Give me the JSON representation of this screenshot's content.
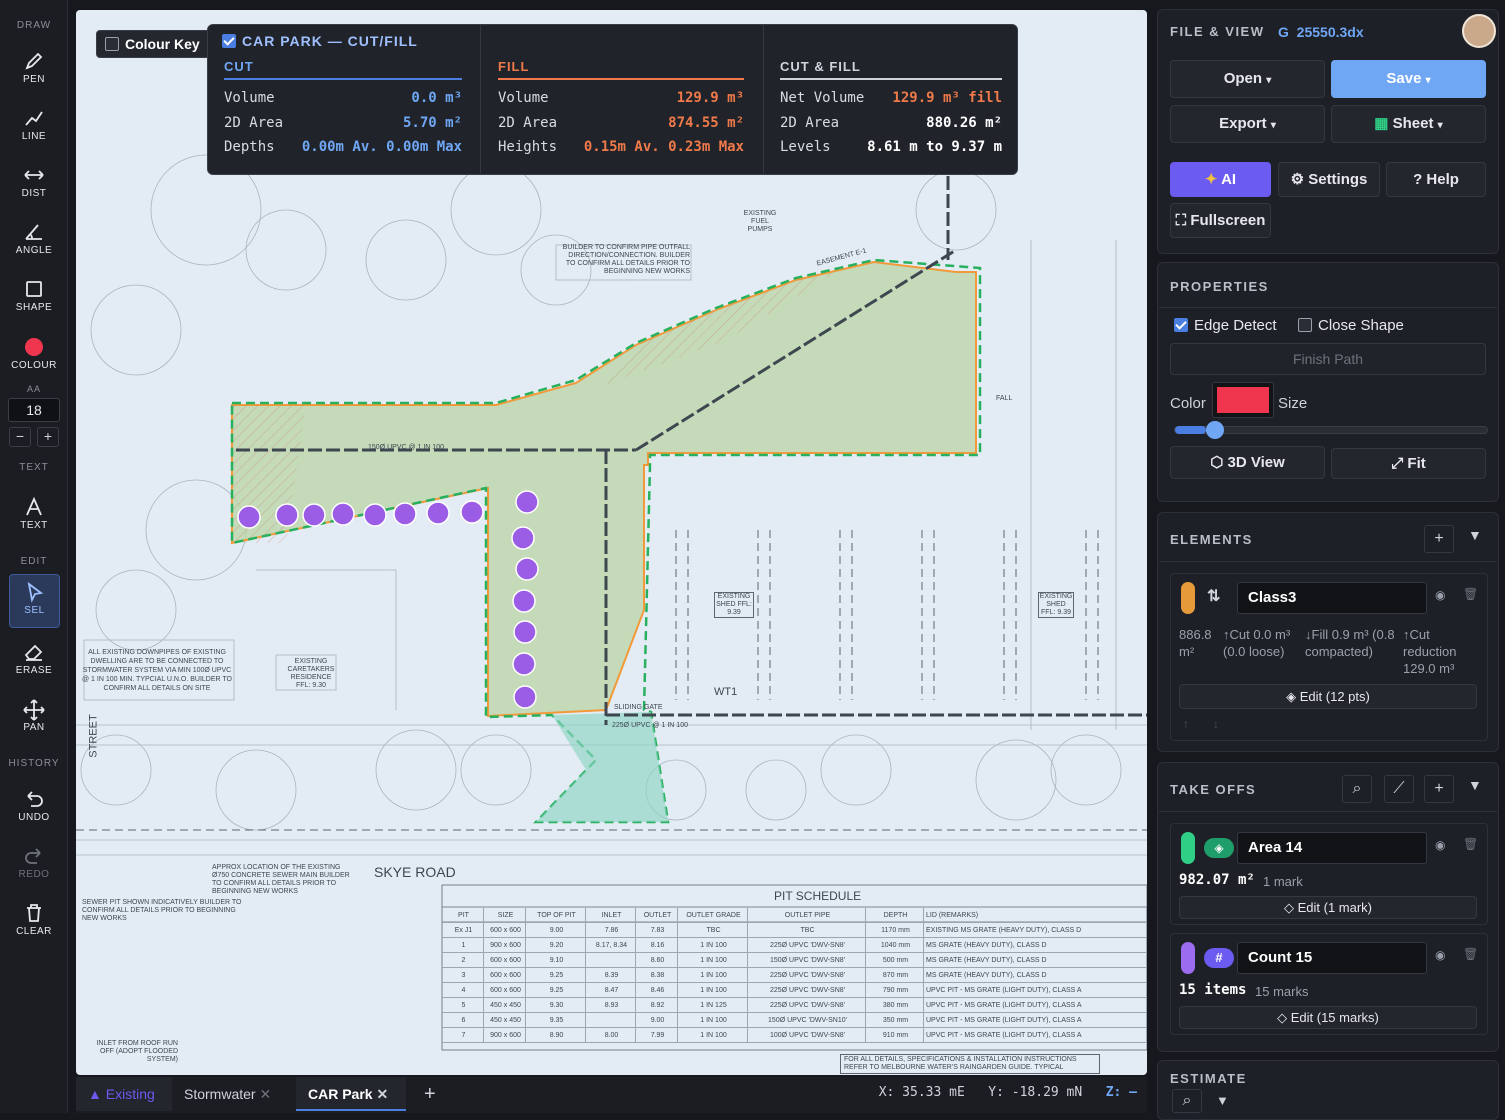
{
  "toolbar": {
    "draw_label": "DRAW",
    "pen": "PEN",
    "line": "LINE",
    "dist": "DIST",
    "angle": "ANGLE",
    "shape": "SHAPE",
    "colour": "COLOUR",
    "aa": "AA",
    "size_value": "18",
    "minus": "−",
    "plus": "+",
    "text_label": "TEXT",
    "text": "TEXT",
    "edit_label": "EDIT",
    "sel": "SEL",
    "erase": "ERASE",
    "pan": "PAN",
    "history_label": "HISTORY",
    "undo": "UNDO",
    "redo": "REDO",
    "clear": "CLEAR",
    "colour_value": "#f0364f"
  },
  "colour_key": {
    "label": "Colour Key"
  },
  "cutfill": {
    "title": "CAR PARK — CUT/FILL",
    "cut": {
      "header": "CUT",
      "rows": [
        {
          "label": "Volume",
          "value": "0.0 m³"
        },
        {
          "label": "2D Area",
          "value": "5.70 m²"
        }
      ],
      "depths_label": "Depths",
      "depths_value": "0.00m Av. 0.00m Max"
    },
    "fill": {
      "header": "FILL",
      "rows": [
        {
          "label": "Volume",
          "value": "129.9 m³"
        },
        {
          "label": "2D Area",
          "value": "874.55 m²"
        }
      ],
      "heights_label": "Heights",
      "heights_value": "0.15m Av. 0.23m Max"
    },
    "cutfill": {
      "header": "CUT & FILL",
      "rows": [
        {
          "label": "Net Volume",
          "value": "129.9 m³ fill"
        },
        {
          "label": "2D Area",
          "value": "880.26 m²"
        },
        {
          "label": "Levels",
          "value": "8.61 m to 9.37 m"
        }
      ]
    }
  },
  "drawing": {
    "road": "SKYE ROAD",
    "street": "STREET",
    "pit_schedule_title": "PIT SCHEDULE",
    "pit_headers": [
      "PIT",
      "SIZE",
      "TOP OF PIT",
      "INLET",
      "OUTLET",
      "OUTLET GRADE",
      "OUTLET PIPE",
      "DEPTH",
      "LID (REMARKS)"
    ],
    "pit_rows": [
      [
        "Ex J1",
        "600 x 600",
        "9.00",
        "7.86",
        "7.83",
        "TBC",
        "TBC",
        "1170 mm",
        "EXISTING MS GRATE (HEAVY DUTY), CLASS D"
      ],
      [
        "1",
        "900 x 600",
        "9.20",
        "8.17, 8.34",
        "8.16",
        "1 IN 100",
        "225Ø UPVC 'DWV-SN8'",
        "1040 mm",
        "MS GRATE (HEAVY DUTY), CLASS D"
      ],
      [
        "2",
        "600 x 600",
        "9.10",
        "",
        "8.60",
        "1 IN 100",
        "150Ø UPVC 'DWV-SN8'",
        "500 mm",
        "MS GRATE (HEAVY DUTY), CLASS D"
      ],
      [
        "3",
        "600 x 600",
        "9.25",
        "8.39",
        "8.38",
        "1 IN 100",
        "225Ø UPVC 'DWV-SN8'",
        "870 mm",
        "MS GRATE (HEAVY DUTY), CLASS D"
      ],
      [
        "4",
        "600 x 600",
        "9.25",
        "8.47",
        "8.46",
        "1 IN 100",
        "225Ø UPVC 'DWV-SN8'",
        "790 mm",
        "UPVC PIT - MS GRATE (LIGHT DUTY), CLASS A"
      ],
      [
        "5",
        "450 x 450",
        "9.30",
        "8.93",
        "8.92",
        "1 IN 125",
        "225Ø UPVC 'DWV-SN8'",
        "380 mm",
        "UPVC PIT - MS GRATE (LIGHT DUTY), CLASS A"
      ],
      [
        "6",
        "450 x 450",
        "9.35",
        "",
        "9.00",
        "1 IN 100",
        "150Ø UPVC 'DWV-SN10'",
        "350 mm",
        "UPVC PIT - MS GRATE (LIGHT DUTY), CLASS A"
      ],
      [
        "7",
        "900 x 600",
        "8.90",
        "8.00",
        "7.99",
        "1 IN 100",
        "100Ø UPVC 'DWV-SN8'",
        "910 mm",
        "UPVC PIT - MS GRATE (LIGHT DUTY), CLASS A"
      ]
    ],
    "note_downpipes": "ALL EXISTING DOWNPIPES OF EXISTING DWELLING ARE TO BE CONNECTED TO STORMWATER SYSTEM VIA MIN 100Ø UPVC @ 1 IN 100 MIN. TYPCIAL U.N.O. BUILDER TO CONFIRM ALL DETAILS ON SITE",
    "note_sewer": "APPROX LOCATION OF THE EXISTING Ø750 CONCRETE SEWER MAIN BUILDER TO CONFIRM ALL DETAILS PRIOR TO BEGINNING NEW WORKS",
    "note_builder": "BUILDER TO CONFIRM PIPE OUTFALL DIRECTION/CONNECTION. BUILDER TO CONFIRM ALL DETAILS PRIOR TO BEGINNING NEW WORKS",
    "note_sewer_pit": "SEWER PIT SHOWN INDICATIVELY BUILDER TO CONFIRM ALL DETAILS PRIOR TO BEGINNING NEW WORKS",
    "note_bottom": "FOR ALL DETAILS, SPECIFICATIONS & INSTALLATION INSTRUCTIONS REFER TO MELBOURNE WATER'S RAINGARDEN GUIDE. TYPICAL",
    "wt1": "WT1",
    "shed1": "EXISTING SHED FFL: 9.39",
    "shed2": "EXISTING SHED FFL: 9.39",
    "caretaker": "EXISTING CARETAKERS RESIDENCE FFL: 9.30",
    "fuel": "EXISTING FUEL PUMPS",
    "pipe1": "225Ø UPVC @ 1 IN 100",
    "pipe2": "150Ø UPVC @ 1 IN 100",
    "inlet": "INLET FROM ROOF RUN OFF (ADOPT FLOODED SYSTEM)",
    "sliding_gate": "SLIDING GATE",
    "easement": "EASEMENT E-1",
    "fall": "FALL"
  },
  "tabs": {
    "items": [
      {
        "label": "Existing"
      },
      {
        "label": "Stormwater"
      },
      {
        "label": "CAR Park"
      }
    ],
    "add": "+",
    "coord_x": "X: 35.33 mE",
    "coord_y": "Y: -18.29 mN",
    "coord_z": "Z: —"
  },
  "file_view": {
    "title": "FILE & VIEW",
    "file_icon": "G",
    "file_name": "25550.3dx",
    "open": "Open",
    "save": "Save",
    "export": "Export",
    "sheet": "Sheet",
    "ai": "AI",
    "settings": "Settings",
    "help": "Help",
    "fullscreen": "Fullscreen"
  },
  "properties": {
    "title": "PROPERTIES",
    "edge_detect": "Edge Detect",
    "close_shape": "Close Shape",
    "finish_path": "Finish Path",
    "color_label": "Color",
    "size_label": "Size",
    "color_value": "#f0364f",
    "size_fraction": 0.1,
    "view3d": "3D View",
    "fit": "Fit"
  },
  "elements": {
    "title": "ELEMENTS",
    "item": {
      "name": "Class3",
      "color": "#e79a3a",
      "area": "886.8 m²",
      "cut": "↑Cut 0.0 m³ (0.0 loose)",
      "fill": "↓Fill 0.9 m³ (0.8 compacted)",
      "reduction": "↑Cut reduction 129.0 m³",
      "edit": "Edit (12 pts)"
    }
  },
  "takeoffs": {
    "title": "TAKE OFFS",
    "items": [
      {
        "name": "Area 14",
        "color": "#2fcf86",
        "value": "982.07 m²",
        "marks": "1 mark",
        "edit": "Edit (1 mark)"
      },
      {
        "name": "Count 15",
        "color": "#9b6bf0",
        "value": "15 items",
        "marks": "15 marks",
        "edit": "Edit (15 marks)"
      }
    ]
  },
  "estimate": {
    "title": "ESTIMATE"
  }
}
